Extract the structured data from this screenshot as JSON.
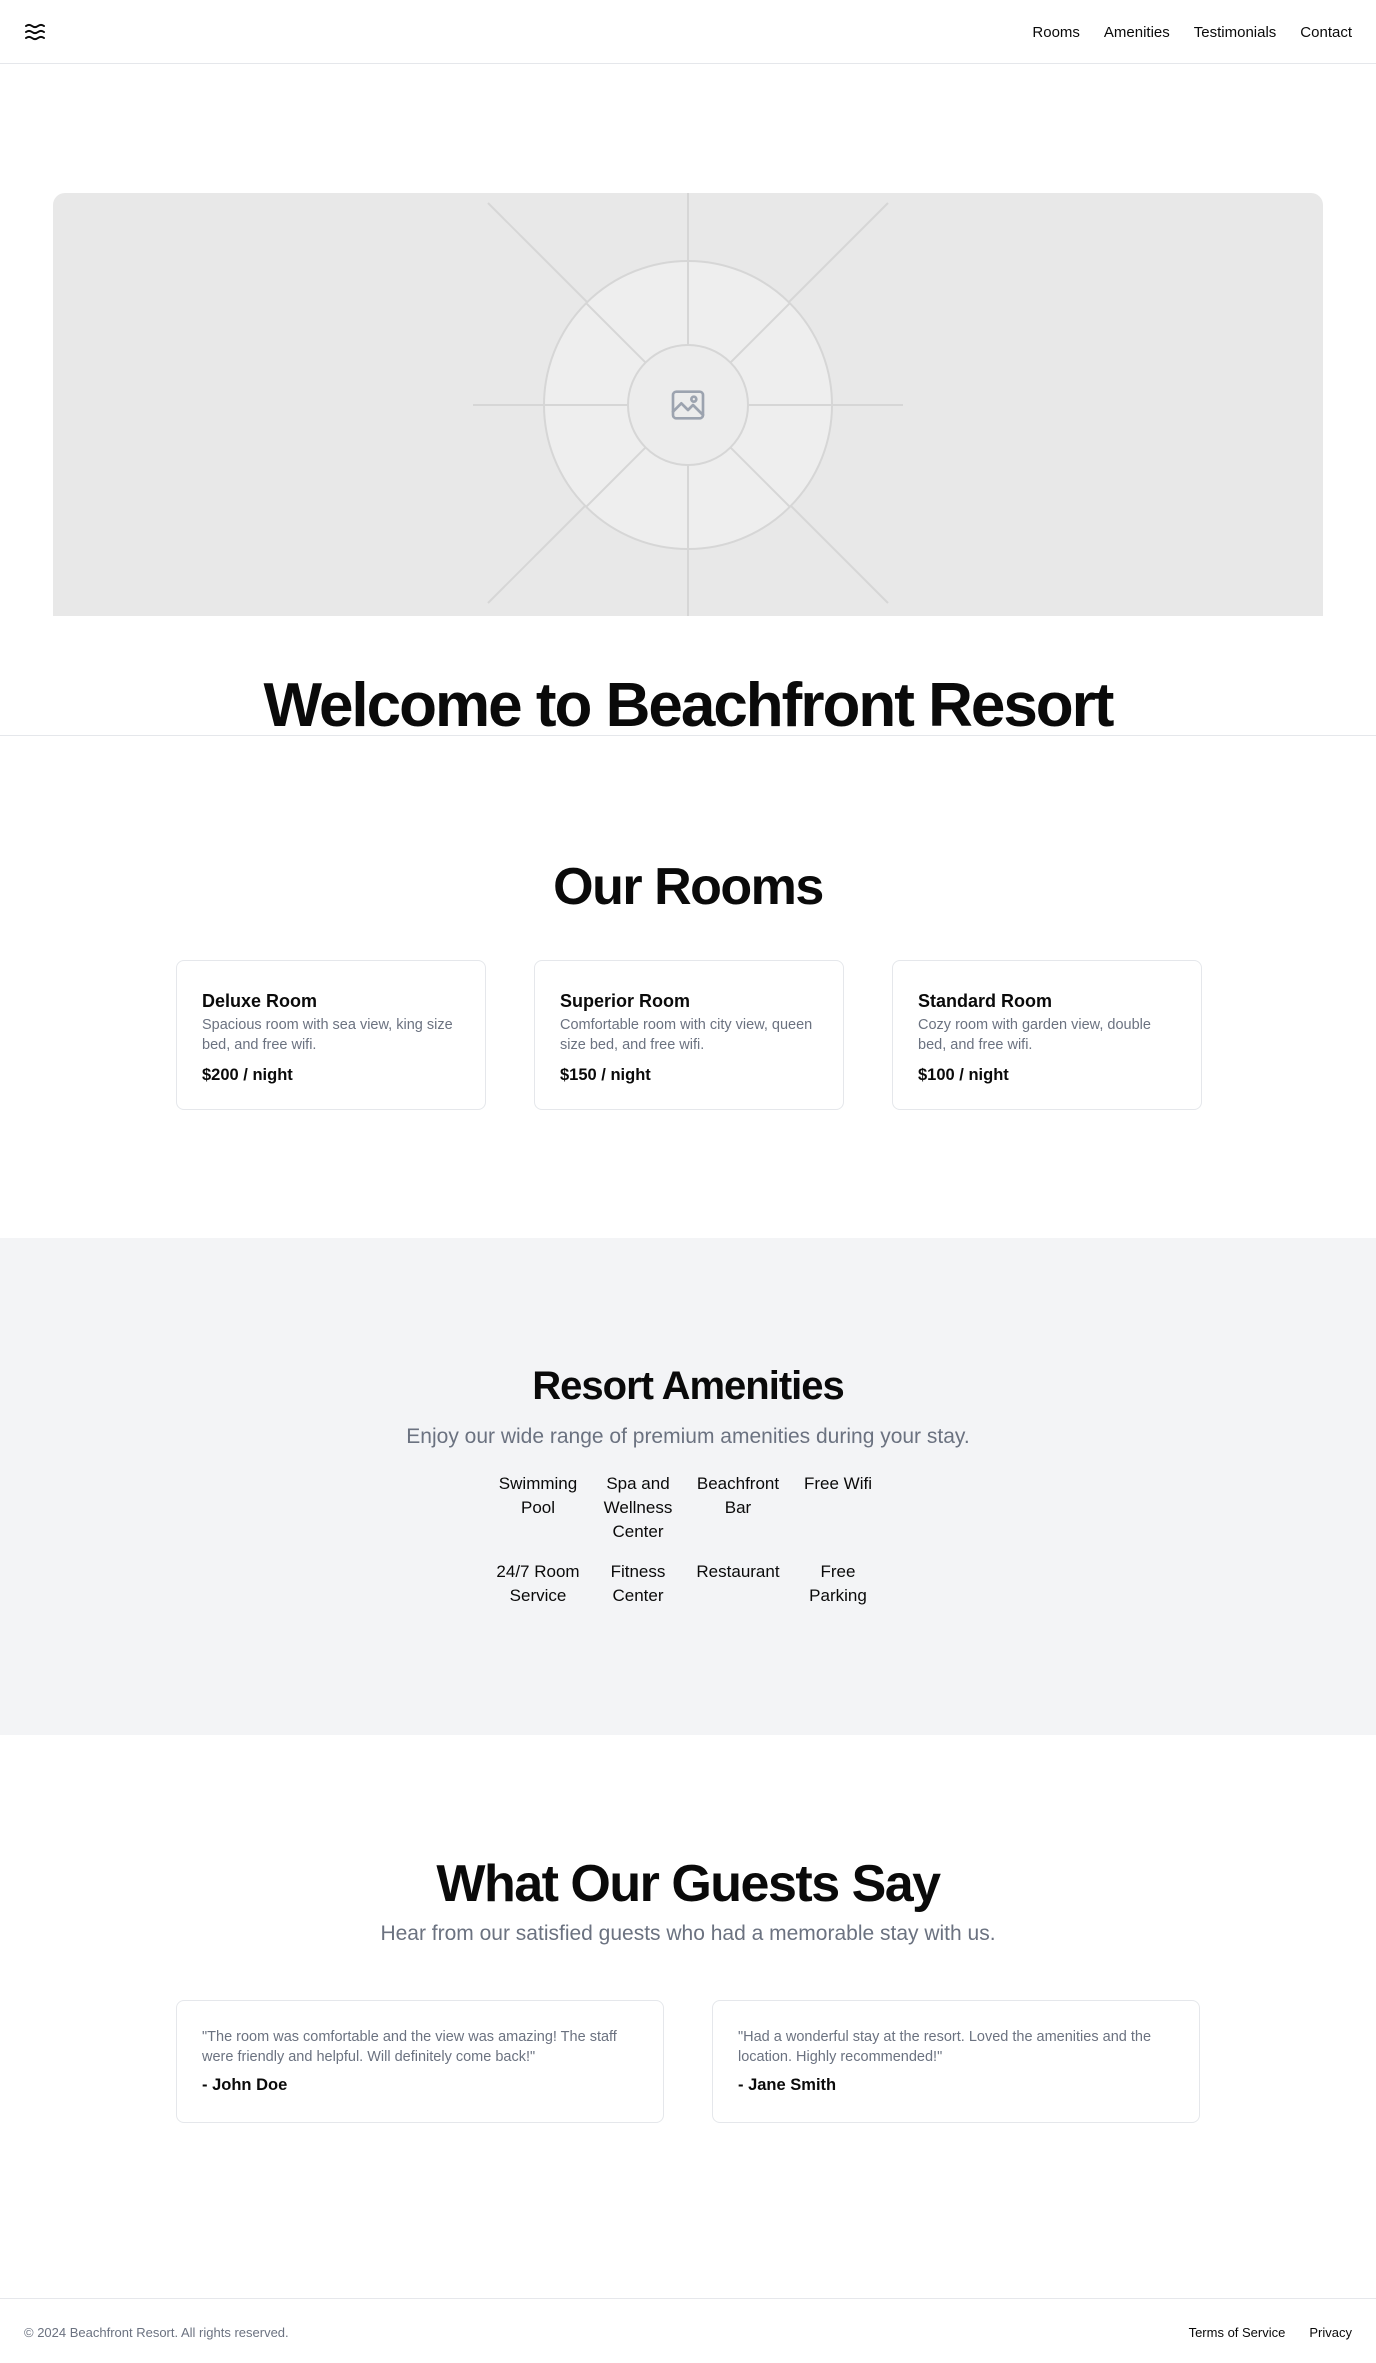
{
  "nav": {
    "items": [
      "Rooms",
      "Amenities",
      "Testimonials",
      "Contact"
    ]
  },
  "hero": {
    "title": "Welcome to Beachfront Resort"
  },
  "rooms": {
    "title": "Our Rooms",
    "items": [
      {
        "name": "Deluxe Room",
        "description": "Spacious room with sea view, king size bed, and free wifi.",
        "price": "$200 / night"
      },
      {
        "name": "Superior Room",
        "description": "Comfortable room with city view, queen size bed, and free wifi.",
        "price": "$150 / night"
      },
      {
        "name": "Standard Room",
        "description": "Cozy room with garden view, double bed, and free wifi.",
        "price": "$100 / night"
      }
    ]
  },
  "amenities": {
    "title": "Resort Amenities",
    "subtitle": "Enjoy our wide range of premium amenities during your stay.",
    "items": [
      "Swimming Pool",
      "Spa and Wellness Center",
      "Beachfront Bar",
      "Free Wifi",
      "24/7 Room Service",
      "Fitness Center",
      "Restaurant",
      "Free Parking"
    ]
  },
  "testimonials": {
    "title": "What Our Guests Say",
    "subtitle": "Hear from our satisfied guests who had a memorable stay with us.",
    "items": [
      {
        "quote": "\"The room was comfortable and the view was amazing! The staff were friendly and helpful. Will definitely come back!\"",
        "author": "- John Doe"
      },
      {
        "quote": "\"Had a wonderful stay at the resort. Loved the amenities and the location. Highly recommended!\"",
        "author": "- Jane Smith"
      }
    ]
  },
  "footer": {
    "copyright": "© 2024 Beachfront Resort. All rights reserved.",
    "links": [
      "Terms of Service",
      "Privacy"
    ]
  },
  "icons": {
    "logo": "waves-icon",
    "hero_placeholder": "image-icon"
  }
}
